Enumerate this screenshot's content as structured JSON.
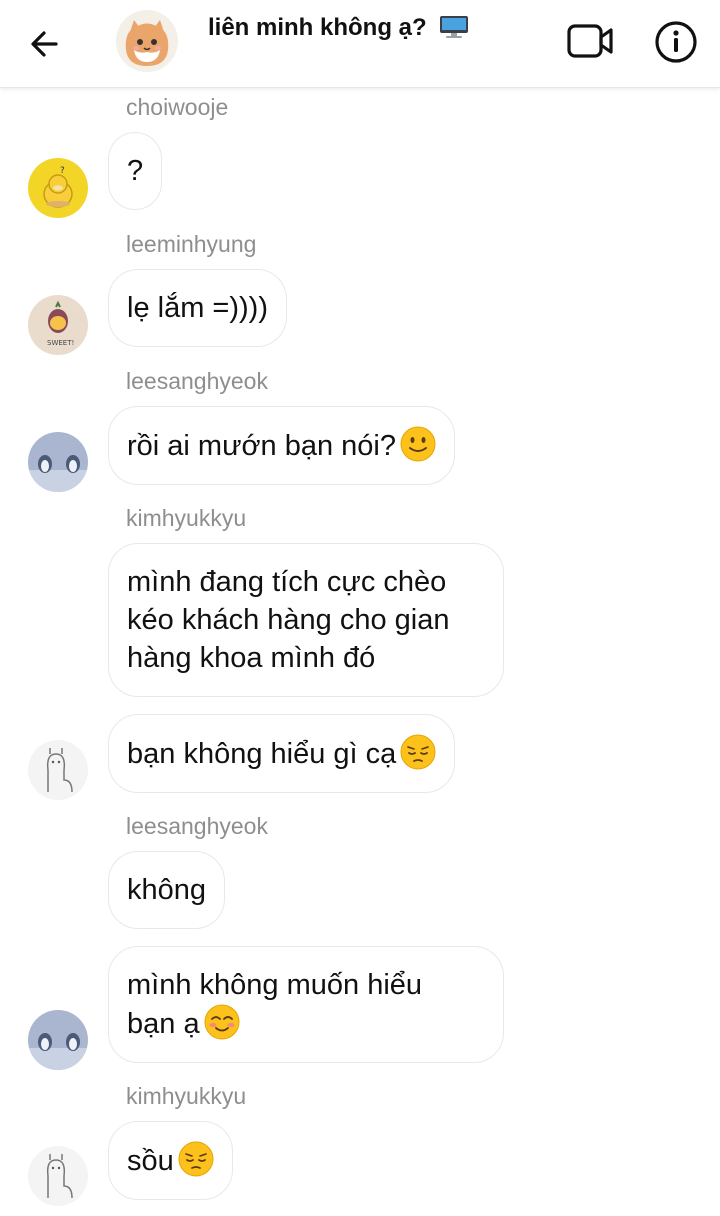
{
  "header": {
    "title": "liên minh không ạ?",
    "title_icon": "desktop-computer-emoji",
    "buttons": [
      "back-arrow-icon",
      "video-call-icon",
      "info-icon"
    ]
  },
  "messages": [
    {
      "sender": "choiwooje",
      "text": "?",
      "avatar": "yellow-duck"
    },
    {
      "sender": "leeminhyung",
      "text": "lẹ lắm =))))",
      "avatar": "sweet-potato"
    },
    {
      "sender": "leesanghyeok",
      "text": "rồi ai mướn bạn nói?",
      "emoji": "slightly-smiling-face",
      "avatar": "penguins"
    },
    {
      "sender": "kimhyukkyu",
      "lines": [
        "mình đang tích cực chèo",
        "kéo khách hàng cho gian",
        "hàng khoa mình đó"
      ]
    },
    {
      "text": "bạn không hiểu gì cạ",
      "emoji": "pensive-face",
      "avatar": "alpaca"
    },
    {
      "sender": "leesanghyeok",
      "text": "không"
    },
    {
      "lines": [
        "mình không muốn hiểu",
        "bạn ạ"
      ],
      "emoji": "smiling-face",
      "avatar": "penguins"
    },
    {
      "sender": "kimhyukkyu",
      "text": "sồu",
      "emoji": "pensive-face",
      "avatar": "alpaca"
    }
  ],
  "colors": {
    "bubble_border": "#e8e8e8",
    "sender_text": "#8e8e8e",
    "text": "#111111"
  }
}
